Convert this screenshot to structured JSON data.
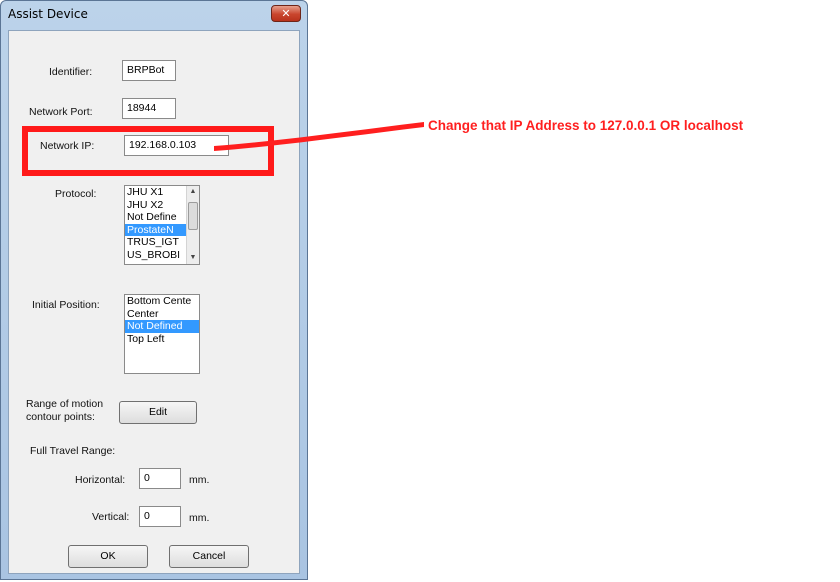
{
  "window": {
    "title": "Assist Device",
    "close_glyph": "✕"
  },
  "identifier": {
    "label": "Identifier:",
    "value": "BRPBot"
  },
  "network_port": {
    "label": "Network Port:",
    "value": "18944"
  },
  "network_ip": {
    "label": "Network IP:",
    "value": "192.168.0.103"
  },
  "protocol": {
    "label": "Protocol:",
    "items": [
      "JHU X1",
      "JHU X2",
      "Not Define",
      "ProstateN",
      "TRUS_IGT",
      "US_BROBI"
    ],
    "selected_index": 3
  },
  "initial_position": {
    "label": "Initial Position:",
    "items": [
      "Bottom Cente",
      "Center",
      "Not Defined",
      "Top Left"
    ],
    "selected_index": 2
  },
  "range_motion": {
    "label_line1": "Range of motion",
    "label_line2": "contour points:",
    "button": "Edit"
  },
  "full_travel": {
    "label": "Full Travel Range:",
    "horizontal_label": "Horizontal:",
    "horizontal_value": "0",
    "vertical_label": "Vertical:",
    "vertical_value": "0",
    "unit": "mm."
  },
  "buttons": {
    "ok": "OK",
    "cancel": "Cancel"
  },
  "annotation": {
    "text": "Change that IP Address to 127.0.0.1 OR localhost",
    "color": "#ff1f1f"
  }
}
